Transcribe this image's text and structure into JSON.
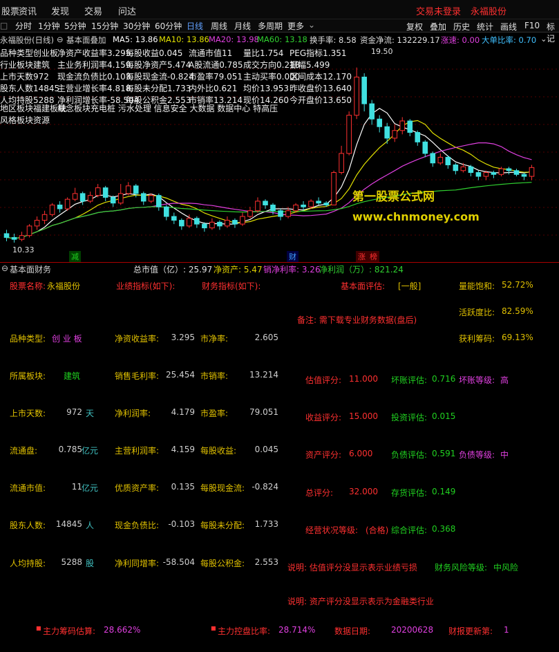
{
  "menubar": {
    "items": [
      "股票",
      "资讯",
      "发现",
      "交易",
      "问达"
    ],
    "trade_status": "交易未登录",
    "stock_name": "永福股份"
  },
  "toolbar": {
    "buttons": [
      "复权",
      "叠加",
      "历史",
      "统计",
      "画线",
      "F10",
      "标记"
    ],
    "periods": [
      "分时",
      "1分钟",
      "5分钟",
      "15分钟",
      "30分钟",
      "60分钟",
      "日线",
      "周线",
      "月线",
      "多周期",
      "更多"
    ],
    "active_period": "日线"
  },
  "chart_header": {
    "title": "永福股份(日线)",
    "overlay": "基本面叠加",
    "ma5": "MA5: 13.86",
    "ma10": "MA10: 13.86",
    "ma20": "MA20: 13.98",
    "ma60": "MA60: 13.18",
    "turnover": "换手率: 8.58",
    "net_inflow": "资金净流: 132229.17",
    "speed": "涨速: 0.00",
    "big_ratio": "大单比率: 0.70"
  },
  "overlay_info": {
    "rows": [
      [
        "品种类型创业板",
        "净资产收益率3.295",
        "每股收益0.045",
        "流通市值11",
        "量比1.754",
        "PEG指标1.351"
      ],
      [
        "行业板块建筑",
        "主业务利润率4.159",
        "每股净资产5.474",
        "A股流通0.785",
        "成交方向0.218",
        "振幅5.499"
      ],
      [
        "上市天数972",
        "现金流负债比0.103",
        "每股现金流-0.824",
        "市盈率79.051",
        "主动买率0.000",
        "区间成本12.170"
      ],
      [
        "股东人数14845",
        "主营业增长率4.818",
        "每股未分配1.733",
        "内外比0.621",
        "均价13.953",
        "昨收盘价13.640"
      ],
      [
        "人均持股5288",
        "净利润增长率-58.504",
        "每股公积金2.553",
        "市销率13.214",
        "现价14.260",
        "今开盘价13.650"
      ]
    ],
    "region": "地区板块福建板块",
    "concept": "概念板块充电桩 污水处理 信息安全 大数据 数据中心 特高压",
    "style": "风格板块资源"
  },
  "chart_annotations": {
    "high": "19.50",
    "low": "10.33",
    "watermark1": "第一股票公式网",
    "watermark2": "www.chnmoney.com",
    "markers": [
      "减",
      "财",
      "涨",
      "榜"
    ]
  },
  "chart_data": {
    "type": "candlestick",
    "title": "永福股份(日线)",
    "note": "Approximate daily candles (open, close, high, low) read visually",
    "ylim": [
      10.0,
      20.5
    ],
    "candles": [
      [
        10.8,
        10.6,
        11.0,
        10.4
      ],
      [
        10.6,
        10.5,
        10.8,
        10.33
      ],
      [
        10.5,
        10.7,
        10.9,
        10.4
      ],
      [
        10.7,
        11.2,
        11.3,
        10.6
      ],
      [
        11.2,
        11.5,
        11.7,
        11.0
      ],
      [
        11.5,
        11.8,
        12.0,
        11.3
      ],
      [
        11.8,
        12.3,
        12.4,
        11.7
      ],
      [
        12.3,
        12.1,
        12.5,
        11.9
      ],
      [
        12.1,
        12.6,
        12.7,
        12.0
      ],
      [
        12.6,
        12.9,
        13.2,
        12.5
      ],
      [
        12.9,
        12.5,
        13.0,
        12.3
      ],
      [
        12.5,
        12.8,
        13.0,
        12.4
      ],
      [
        12.8,
        13.2,
        13.4,
        12.7
      ],
      [
        13.2,
        12.7,
        13.3,
        12.5
      ],
      [
        12.7,
        12.4,
        12.8,
        12.2
      ],
      [
        12.4,
        12.9,
        13.4,
        12.3
      ],
      [
        12.9,
        13.3,
        13.5,
        12.8
      ],
      [
        13.3,
        12.9,
        13.4,
        12.7
      ],
      [
        12.9,
        12.5,
        13.0,
        12.3
      ],
      [
        12.5,
        12.8,
        12.9,
        12.4
      ],
      [
        12.8,
        12.2,
        12.9,
        12.0
      ],
      [
        12.2,
        11.7,
        12.3,
        11.5
      ],
      [
        11.7,
        11.5,
        11.9,
        11.3
      ],
      [
        11.5,
        11.2,
        11.6,
        11.0
      ],
      [
        11.2,
        11.6,
        11.8,
        11.1
      ],
      [
        11.6,
        11.3,
        11.7,
        11.1
      ],
      [
        11.3,
        11.1,
        11.4,
        10.9
      ],
      [
        11.1,
        11.4,
        11.6,
        11.0
      ],
      [
        11.4,
        11.2,
        11.5,
        11.0
      ],
      [
        11.2,
        11.5,
        11.7,
        11.1
      ],
      [
        11.5,
        11.3,
        11.6,
        11.1
      ],
      [
        11.3,
        11.7,
        11.9,
        11.2
      ],
      [
        11.7,
        12.0,
        12.2,
        11.6
      ],
      [
        12.0,
        12.5,
        12.7,
        11.9
      ],
      [
        12.5,
        12.3,
        12.6,
        12.1
      ],
      [
        12.3,
        12.0,
        12.4,
        11.8
      ],
      [
        12.0,
        11.7,
        12.1,
        11.5
      ],
      [
        11.7,
        12.0,
        12.2,
        11.6
      ],
      [
        12.0,
        12.3,
        12.4,
        11.9
      ],
      [
        12.3,
        12.2,
        12.5,
        12.0
      ],
      [
        12.2,
        12.5,
        12.6,
        12.1
      ],
      [
        12.5,
        12.4,
        12.7,
        12.3
      ],
      [
        12.4,
        12.3,
        12.5,
        12.2
      ],
      [
        12.3,
        14.0,
        14.1,
        12.3
      ],
      [
        14.0,
        15.0,
        15.4,
        13.9
      ],
      [
        15.0,
        17.0,
        17.2,
        14.9
      ],
      [
        17.0,
        19.0,
        19.5,
        16.8
      ],
      [
        19.0,
        17.6,
        19.2,
        17.2
      ],
      [
        17.6,
        16.8,
        17.8,
        16.5
      ],
      [
        16.8,
        16.4,
        17.0,
        16.1
      ],
      [
        16.4,
        15.8,
        16.6,
        15.5
      ],
      [
        15.8,
        16.2,
        16.5,
        15.6
      ],
      [
        16.2,
        16.7,
        16.9,
        16.0
      ],
      [
        16.7,
        16.1,
        16.8,
        15.9
      ],
      [
        16.1,
        15.6,
        16.2,
        15.4
      ],
      [
        15.6,
        15.0,
        15.7,
        14.8
      ],
      [
        15.0,
        14.5,
        15.1,
        14.3
      ],
      [
        14.5,
        14.8,
        15.0,
        14.4
      ],
      [
        14.8,
        14.4,
        14.9,
        14.2
      ],
      [
        14.4,
        14.1,
        14.5,
        13.9
      ],
      [
        14.1,
        14.3,
        14.5,
        14.0
      ],
      [
        14.3,
        14.0,
        14.4,
        13.8
      ],
      [
        14.0,
        13.8,
        14.1,
        13.6
      ],
      [
        13.8,
        14.0,
        14.1,
        13.6
      ],
      [
        14.0,
        13.9,
        14.1,
        13.7
      ],
      [
        13.9,
        14.2,
        14.3,
        13.8
      ],
      [
        14.2,
        14.1,
        14.3,
        13.9
      ],
      [
        14.1,
        13.9,
        14.2,
        13.8
      ],
      [
        13.9,
        13.8,
        14.0,
        13.6
      ],
      [
        13.8,
        14.26,
        14.4,
        13.6
      ]
    ]
  },
  "fundamental_panel": {
    "header": "基本面财务",
    "market_cap_label": "总市值（亿）: 25.97",
    "net_assets_label": "净资产: 5.47",
    "net_margin_label": "销净利率: 3.26",
    "net_profit_label": "净利润（万）: 821.24",
    "stock_name_label": "股票名称:",
    "stock_name_value": "永福股份",
    "perf_label": "业绩指标(如下):",
    "fin_label": "财务指标(如下):",
    "eval_label": "基本面评估:",
    "eval_value": "[一般]",
    "vol_sat_label": "量能饱和:",
    "vol_sat_value": "52.72%",
    "activity_label": "活跃度比:",
    "activity_value": "82.59%",
    "note": "备注: 需下载专业财务数据(盘后)",
    "profit_chip_label": "获利筹码:",
    "profit_chip_value": "69.13%",
    "left": [
      {
        "label": "品种类型:",
        "value": "创 业 板",
        "unit": ""
      },
      {
        "label": "所属板块:",
        "value": "建筑",
        "unit": ""
      },
      {
        "label": "上市天数:",
        "value": "972",
        "unit": "天"
      },
      {
        "label": "流通盘:",
        "value": "0.785",
        "unit": "亿元"
      },
      {
        "label": "流通市值:",
        "value": "11",
        "unit": "亿元"
      },
      {
        "label": "股东人数:",
        "value": "14845",
        "unit": "人"
      },
      {
        "label": "人均持股:",
        "value": "5288",
        "unit": "股"
      }
    ],
    "mid": [
      {
        "label": "净资收益率:",
        "value": "3.295"
      },
      {
        "label": "销售毛利率:",
        "value": "25.454"
      },
      {
        "label": "净利润率:",
        "value": "4.179"
      },
      {
        "label": "主营利润率:",
        "value": "4.159"
      },
      {
        "label": "优质资产率:",
        "value": "0.135"
      },
      {
        "label": "现金负债比:",
        "value": "-0.103"
      },
      {
        "label": "净利同增率:",
        "value": "-58.504"
      }
    ],
    "right": [
      {
        "label": "市净率:",
        "value": "2.605"
      },
      {
        "label": "市销率:",
        "value": "13.214"
      },
      {
        "label": "市盈率:",
        "value": "79.051"
      },
      {
        "label": "每股收益:",
        "value": "0.045"
      },
      {
        "label": "每股现金流:",
        "value": "-0.824"
      },
      {
        "label": "每股未分配:",
        "value": "1.733"
      },
      {
        "label": "每股公积金:",
        "value": "2.553"
      }
    ],
    "scores": [
      {
        "label": "估值评分:",
        "value": "11.000",
        "l2": "坏账评估:",
        "v2": "0.716",
        "l3": "坏账等级:",
        "v3": "高"
      },
      {
        "label": "收益评分:",
        "value": "15.000",
        "l2": "投资评估:",
        "v2": "0.015",
        "l3": "",
        "v3": ""
      },
      {
        "label": "资产评分:",
        "value": "6.000",
        "l2": "负债评估:",
        "v2": "0.591",
        "l3": "负债等级:",
        "v3": "中"
      },
      {
        "label": "总评分:",
        "value": "32.000",
        "l2": "存货评估:",
        "v2": "0.149",
        "l3": "",
        "v3": ""
      },
      {
        "label": "经营状况等级:",
        "value": "(合格)",
        "l2": "综合评估:",
        "v2": "0.368",
        "l3": "",
        "v3": ""
      }
    ],
    "explain1": "说明: 估值评分没显示表示业绩亏损",
    "risk_label": "财务风险等级:",
    "risk_value": "中风险",
    "explain2": "说明: 资产评分没显示表示为金融类行业",
    "main_chip_label": "主力筹码估算:",
    "main_chip_value": "28.662%",
    "main_ctrl_label": "主力控盘比率:",
    "main_ctrl_value": "28.714%",
    "date_label": "数据日期:",
    "date_value": "20200628",
    "update_label": "财报更新第:",
    "update_value": "1"
  },
  "colors": {
    "up": "#ff3030",
    "down": "#40e0e0",
    "ma5": "#ffffff",
    "ma10": "#e0e000",
    "ma20": "#e040e0",
    "ma60": "#30d030",
    "label": "#e0c000",
    "red": "#ff3030",
    "green": "#30d030",
    "magenta": "#e040e0",
    "cyan": "#40c0c0"
  }
}
